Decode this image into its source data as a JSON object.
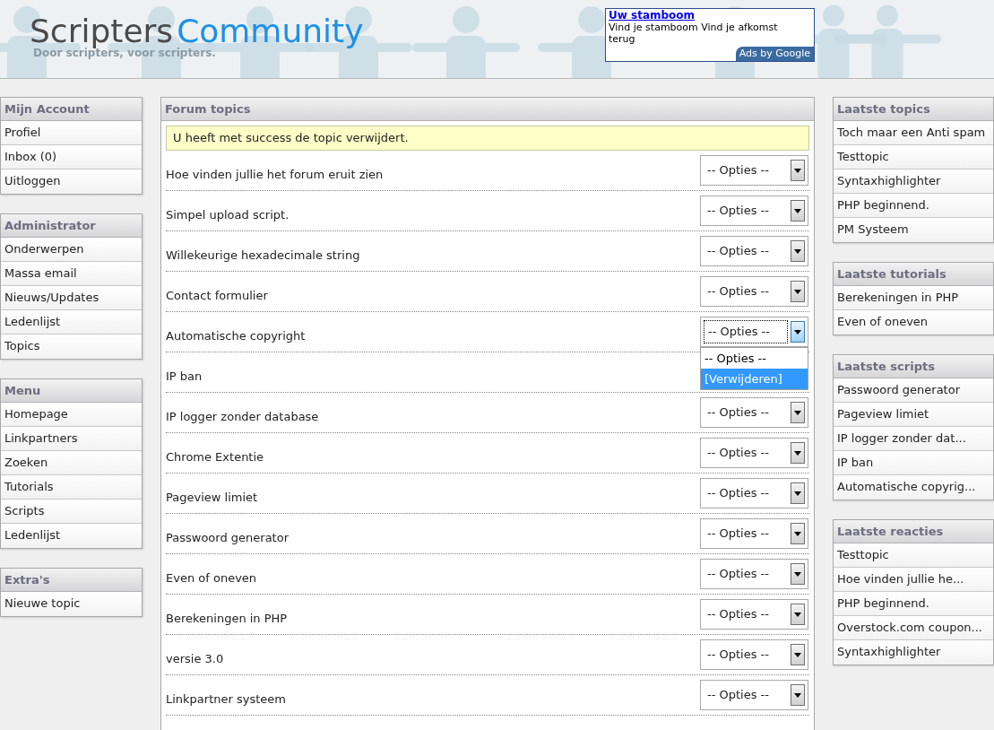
{
  "header": {
    "logo_part1": "Scripters",
    "logo_part2": "Community",
    "tagline": "Door scripters, voor scripters.",
    "ad": {
      "title": "Uw stamboom",
      "text": "Vind je stamboom Vind je afkomst terug",
      "badge": "Ads by Google"
    }
  },
  "left_sidebar": [
    {
      "title": "Mijn Account",
      "items": [
        "Profiel",
        "Inbox (0)",
        "Uitloggen"
      ]
    },
    {
      "title": "Administrator",
      "items": [
        "Onderwerpen",
        "Massa email",
        "Nieuws/Updates",
        "Ledenlijst",
        "Topics"
      ]
    },
    {
      "title": "Menu",
      "items": [
        "Homepage",
        "Linkpartners",
        "Zoeken",
        "Tutorials",
        "Scripts",
        "Ledenlijst"
      ]
    },
    {
      "title": "Extra's",
      "items": [
        "Nieuwe topic"
      ]
    }
  ],
  "main": {
    "title": "Forum topics",
    "notice": "U heeft met success de topic verwijdert.",
    "topics": [
      {
        "title": "Hoe vinden jullie het forum eruit zien",
        "select": "-- Opties --",
        "expanded": false
      },
      {
        "title": "Simpel upload script.",
        "select": "-- Opties --",
        "expanded": false
      },
      {
        "title": "Willekeurige hexadecimale string",
        "select": "-- Opties --",
        "expanded": false
      },
      {
        "title": "Contact formulier",
        "select": "-- Opties --",
        "expanded": false
      },
      {
        "title": "Automatische copyright",
        "select": "-- Opties --",
        "expanded": true,
        "options": [
          {
            "label": "-- Opties --",
            "selected": false
          },
          {
            "label": "[Verwijderen]",
            "selected": true
          }
        ]
      },
      {
        "title": "IP ban"
      },
      {
        "title": "IP logger zonder database",
        "select": "-- Opties --",
        "expanded": false
      },
      {
        "title": "Chrome Extentie",
        "select": "-- Opties --",
        "expanded": false
      },
      {
        "title": "Pageview limiet",
        "select": "-- Opties --",
        "expanded": false
      },
      {
        "title": "Passwoord generator",
        "select": "-- Opties --",
        "expanded": false
      },
      {
        "title": "Even of oneven",
        "select": "-- Opties --",
        "expanded": false
      },
      {
        "title": "Berekeningen in PHP",
        "select": "-- Opties --",
        "expanded": false
      },
      {
        "title": "versie 3.0",
        "select": "-- Opties --",
        "expanded": false
      },
      {
        "title": "Linkpartner systeem",
        "select": "-- Opties --",
        "expanded": false
      }
    ]
  },
  "right_sidebar": [
    {
      "title": "Laatste topics",
      "items": [
        "Toch maar een Anti spam",
        "Testtopic",
        "Syntaxhighlighter",
        "PHP beginnend.",
        "PM Systeem"
      ]
    },
    {
      "title": "Laatste tutorials",
      "items": [
        "Berekeningen in PHP",
        "Even of oneven"
      ]
    },
    {
      "title": "Laatste scripts",
      "items": [
        "Passwoord generator",
        "Pageview limiet",
        "IP logger zonder dat...",
        "IP ban",
        "Automatische copyrig..."
      ]
    },
    {
      "title": "Laatste reacties",
      "items": [
        "Testtopic",
        "Hoe vinden jullie he...",
        "PHP beginnend.",
        "Overstock.com coupon...",
        "Syntaxhighlighter"
      ]
    }
  ]
}
